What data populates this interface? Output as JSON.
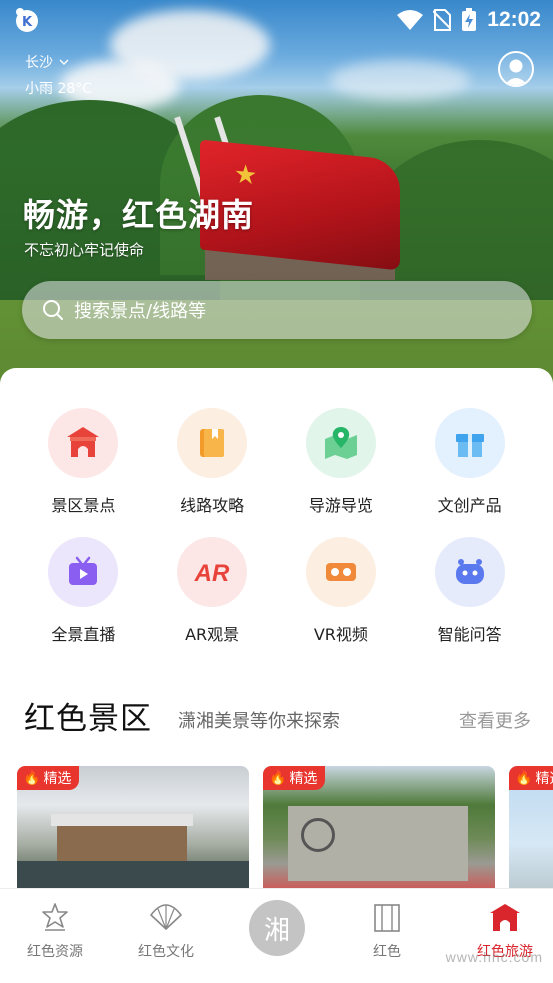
{
  "status": {
    "time": "12:02"
  },
  "weather": {
    "city": "长沙",
    "condition": "小雨 28°C"
  },
  "hero": {
    "title": "畅游，红色湖南",
    "subtitle": "不忘初心牢记使命"
  },
  "search": {
    "placeholder": "搜索景点/线路等"
  },
  "grid": [
    {
      "label": "景区景点",
      "icon": "gate-icon",
      "bg": "#fde6e6",
      "color": "#e8433b"
    },
    {
      "label": "线路攻略",
      "icon": "book-icon",
      "bg": "#fdeee2",
      "color": "#f29b2a"
    },
    {
      "label": "导游导览",
      "icon": "map-pin-icon",
      "bg": "#e2f5ea",
      "color": "#27b567"
    },
    {
      "label": "文创产品",
      "icon": "gift-icon",
      "bg": "#e3f0fd",
      "color": "#3fa3ee"
    },
    {
      "label": "全景直播",
      "icon": "tv-icon",
      "bg": "#ebe6fb",
      "color": "#8a5ef0"
    },
    {
      "label": "AR观景",
      "icon": "ar-icon",
      "bg": "#fde6e6",
      "color": "#e8433b"
    },
    {
      "label": "VR视频",
      "icon": "vr-icon",
      "bg": "#fdeee2",
      "color": "#f08a3a"
    },
    {
      "label": "智能问答",
      "icon": "robot-icon",
      "bg": "#e6ebfb",
      "color": "#5b79ee"
    }
  ],
  "section": {
    "title": "红色景区",
    "subtitle": "潇湘美景等你来探索",
    "more": "查看更多"
  },
  "cards": [
    {
      "tag": "精选"
    },
    {
      "tag": "精选"
    },
    {
      "tag": "精选"
    }
  ],
  "tabs": [
    {
      "label": "红色资源",
      "icon": "star-badge-icon"
    },
    {
      "label": "红色文化",
      "icon": "fan-icon"
    },
    {
      "label": "湘",
      "icon": "center-logo"
    },
    {
      "label": "红色",
      "icon": "building-icon"
    },
    {
      "label": "红色旅游",
      "icon": "gate-icon",
      "active": true
    }
  ],
  "watermark": "www.hnc.com"
}
